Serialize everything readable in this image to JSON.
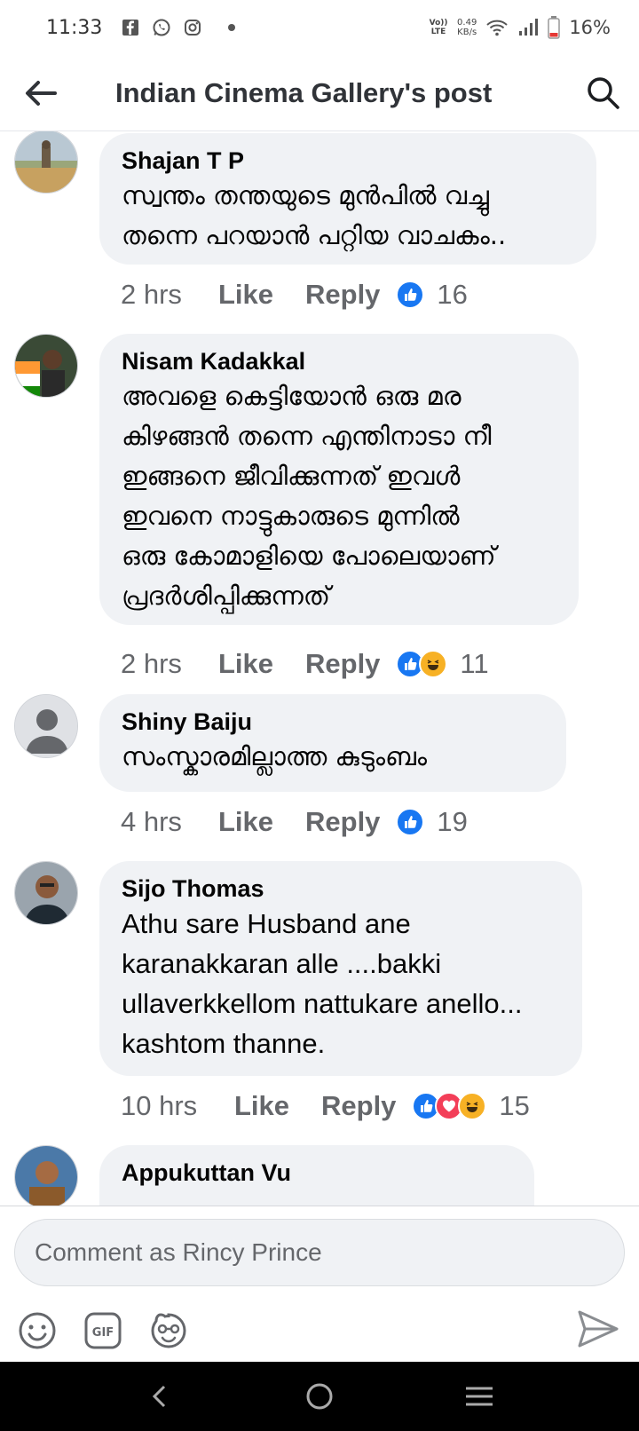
{
  "status_bar": {
    "time": "11:33",
    "volte_label": "Vo)) LTE",
    "net_speed_value": "0.49",
    "net_speed_unit": "KB/s",
    "battery": "16%"
  },
  "header": {
    "title": "Indian Cinema Gallery's post"
  },
  "comments": [
    {
      "author": "Shajan T P",
      "text_lines": [
        "സ്വന്തം തന്തയുടെ മുൻപിൽ വച്ചു",
        "തന്നെ പറയാൻ പറ്റിയ വാചകം.."
      ],
      "time": "2 hrs",
      "like": "Like",
      "reply": "Reply",
      "reactions": [
        "like"
      ],
      "count": "16"
    },
    {
      "author": "Nisam Kadakkal",
      "text_lines": [
        "അവളെ കെട്ടിയോൻ ഒരു മര",
        "കിഴങ്ങൻ തന്നെ എന്തിനാടാ നീ",
        "ഇങ്ങനെ ജീവിക്കുന്നത്  ഇവൾ",
        "ഇവനെ നാട്ടുകാരുടെ മുന്നിൽ",
        "ഒരു കോമാളിയെ പോലെയാണ്",
        "പ്രദർശിപ്പിക്കുന്നത്"
      ],
      "time": "2 hrs",
      "like": "Like",
      "reply": "Reply",
      "reactions": [
        "like",
        "haha"
      ],
      "count": "11"
    },
    {
      "author": "Shiny Baiju",
      "text_lines": [
        "സംസ്കാരമില്ലാത്ത കുടുംബം"
      ],
      "time": "4 hrs",
      "like": "Like",
      "reply": "Reply",
      "reactions": [
        "like"
      ],
      "count": "19"
    },
    {
      "author": "Sijo Thomas",
      "text_lines": [
        "Athu sare Husband ane",
        "karanakkaran alle ....bakki",
        "ullaverkkellom nattukare anello...",
        "kashtom thanne."
      ],
      "time": "10 hrs",
      "like": "Like",
      "reply": "Reply",
      "reactions": [
        "like",
        "love",
        "haha"
      ],
      "count": "15"
    },
    {
      "author": "Appukuttan Vu"
    }
  ],
  "compose": {
    "placeholder": "Comment as Rincy Prince",
    "tools": [
      "emoji-icon",
      "gif-icon",
      "sticker-icon"
    ],
    "send_icon": "send-icon"
  },
  "colors": {
    "facebook_blue": "#1877f2",
    "bubble_bg": "#f0f2f5",
    "meta_gray": "#65676b",
    "love_red": "#f33e58",
    "haha_yellow": "#f7b125"
  }
}
